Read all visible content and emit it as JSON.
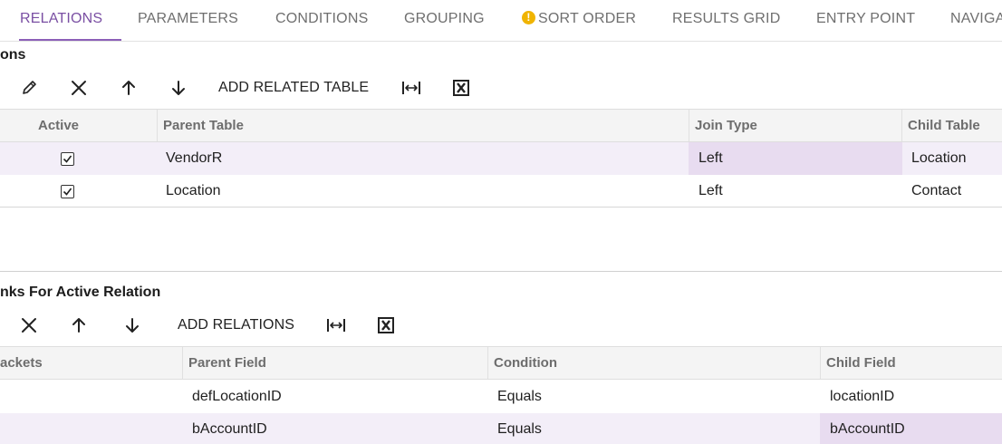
{
  "tabs": [
    {
      "label": "RELATIONS",
      "active": true,
      "warning": false
    },
    {
      "label": "PARAMETERS",
      "active": false,
      "warning": false
    },
    {
      "label": "CONDITIONS",
      "active": false,
      "warning": false
    },
    {
      "label": "GROUPING",
      "active": false,
      "warning": false
    },
    {
      "label": "SORT ORDER",
      "active": false,
      "warning": true
    },
    {
      "label": "RESULTS GRID",
      "active": false,
      "warning": false
    },
    {
      "label": "ENTRY POINT",
      "active": false,
      "warning": false
    },
    {
      "label": "NAVIGA",
      "active": false,
      "warning": false
    }
  ],
  "relations": {
    "title": "ons",
    "toolbar": {
      "icons": [
        "edit-icon",
        "delete-icon",
        "move-up-icon",
        "move-down-icon",
        "fit-columns-icon",
        "export-excel-icon"
      ],
      "add_label": "ADD RELATED TABLE"
    },
    "columns": [
      "Active",
      "Parent Table",
      "Join Type",
      "Child Table"
    ],
    "rows": [
      {
        "active": true,
        "parent_table": "VendorR",
        "join_type": "Left",
        "child_table": "Location",
        "selected": true
      },
      {
        "active": true,
        "parent_table": "Location",
        "join_type": "Left",
        "child_table": "Contact",
        "selected": false
      }
    ]
  },
  "links": {
    "title": "nks For Active Relation",
    "toolbar": {
      "icons": [
        "delete-icon",
        "move-up-icon",
        "move-down-icon",
        "fit-columns-icon",
        "export-excel-icon"
      ],
      "add_label": "ADD RELATIONS"
    },
    "columns": [
      "ackets",
      "Parent Field",
      "Condition",
      "Child Field"
    ],
    "rows": [
      {
        "brackets": "",
        "parent_field": "defLocationID",
        "condition": "Equals",
        "child_field": "locationID",
        "selected": false
      },
      {
        "brackets": "",
        "parent_field": "bAccountID",
        "condition": "Equals",
        "child_field": "bAccountID",
        "selected": true
      }
    ]
  },
  "colors": {
    "accent": "#7a4fa3",
    "selected_row": "#f3eef8",
    "focused_cell": "#e8dcf0",
    "warning": "#f0b400"
  }
}
